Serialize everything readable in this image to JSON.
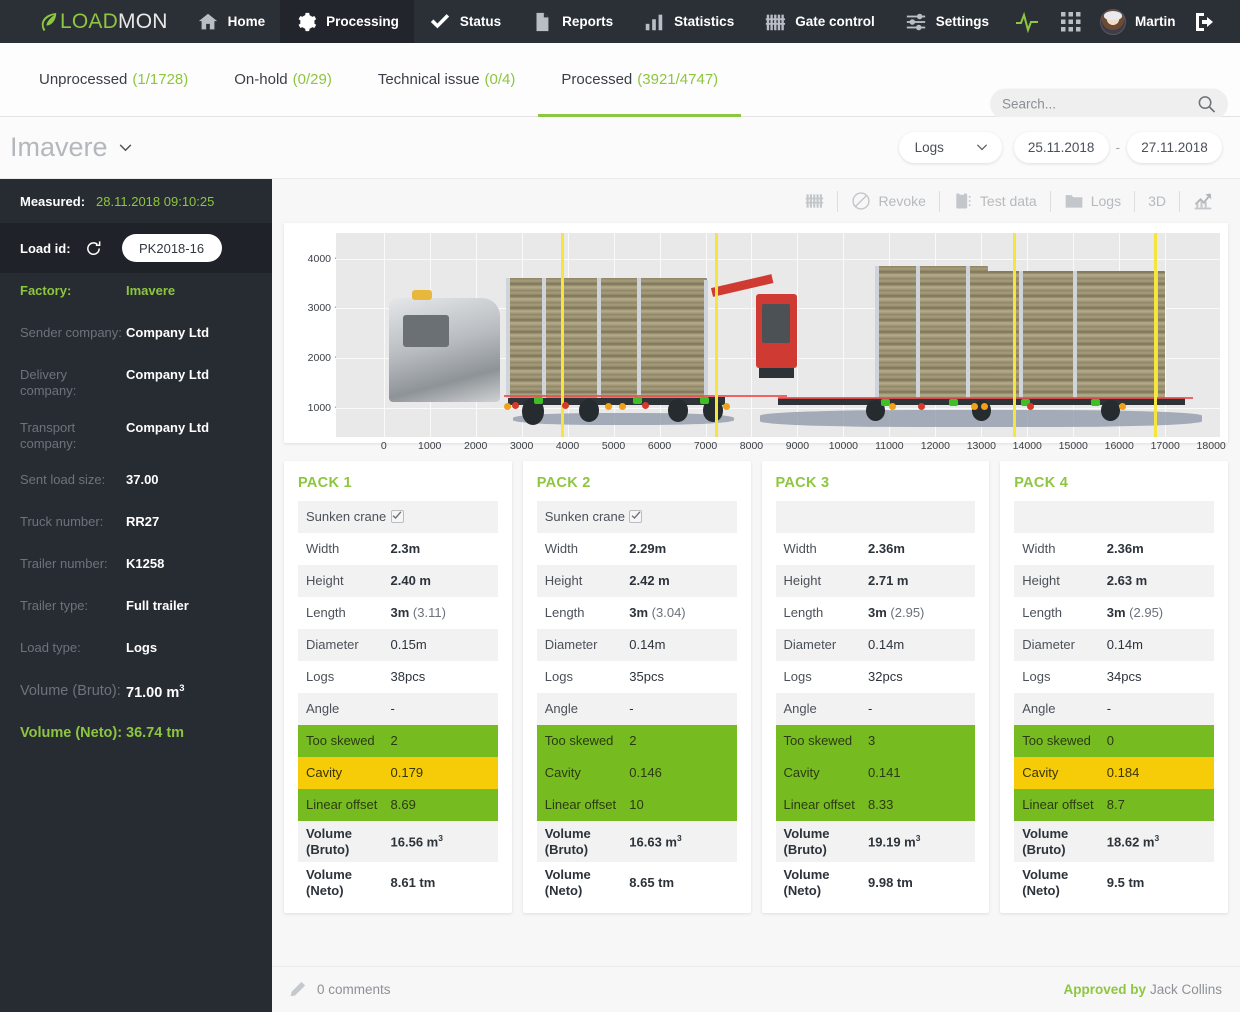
{
  "brand": {
    "load": "LOAD",
    "mon": "MON",
    "accent": "#8dc63f"
  },
  "topnav": {
    "items": [
      {
        "label": "Home",
        "icon": "home-icon",
        "active": false
      },
      {
        "label": "Processing",
        "icon": "gear-icon",
        "active": true
      },
      {
        "label": "Status",
        "icon": "check-icon",
        "active": false
      },
      {
        "label": "Reports",
        "icon": "document-icon",
        "active": false
      },
      {
        "label": "Statistics",
        "icon": "bar-chart-icon",
        "active": false
      },
      {
        "label": "Gate control",
        "icon": "gate-icon",
        "active": false
      },
      {
        "label": "Settings",
        "icon": "sliders-icon",
        "active": false
      }
    ],
    "pulse_icon": "pulse-icon",
    "apps_icon": "grid-apps-icon",
    "username": "Martin",
    "logout_icon": "logout-icon"
  },
  "tabs": [
    {
      "label": "Unprocessed",
      "count": "(1/1728)",
      "active": false
    },
    {
      "label": "On-hold",
      "count": "(0/29)",
      "active": false
    },
    {
      "label": "Technical issue",
      "count": "(0/4)",
      "active": false
    },
    {
      "label": "Processed",
      "count": "(3921/4747)",
      "active": true
    }
  ],
  "search": {
    "placeholder": "Search...",
    "value": "",
    "icon": "search-icon"
  },
  "subheader": {
    "factory": "Imavere",
    "load_type_select": "Logs",
    "date_from": "25.11.2018",
    "date_to": "27.11.2018",
    "date_separator": "-"
  },
  "sidebar": {
    "measured_label": "Measured:",
    "measured_value": "28.11.2018 09:10:25",
    "load_id_label": "Load id:",
    "load_id_value": "PK2018-16",
    "refresh_icon": "refresh-icon",
    "fields": [
      {
        "key": "Factory:",
        "value": "Imavere",
        "accent": true
      },
      {
        "key": "Sender company:",
        "value": "Company Ltd"
      },
      {
        "key": "Delivery company:",
        "value": "Company Ltd"
      },
      {
        "key": "Transport company:",
        "value": "Company Ltd"
      },
      {
        "key": "Sent load size:",
        "value": "37.00"
      },
      {
        "key": "Truck number:",
        "value": "RR27"
      },
      {
        "key": "Trailer number:",
        "value": "K1258"
      },
      {
        "key": "Trailer type:",
        "value": "Full trailer"
      },
      {
        "key": "Load type:",
        "value": "Logs"
      },
      {
        "key": "Volume (Bruto):",
        "value": "71.00 m",
        "sup": "3"
      },
      {
        "key": "Volume (Neto):",
        "value": "36.74 tm",
        "accent": true,
        "big": true
      }
    ]
  },
  "toolbar": {
    "gate_icon": "gate-icon",
    "revoke": "Revoke",
    "revoke_icon": "no-entry-icon",
    "test_data": "Test data",
    "test_data_icon": "clipboard-icon",
    "logs": "Logs",
    "logs_icon": "folder-icon",
    "three_d": "3D",
    "trend_icon": "trend-up-icon"
  },
  "chart_data": {
    "type": "scatter",
    "title": "",
    "xlabel": "",
    "ylabel": "",
    "xlim": [
      -700,
      19000
    ],
    "ylim": [
      400,
      4400
    ],
    "x_ticks": [
      0,
      1000,
      2000,
      3000,
      4000,
      5000,
      6000,
      7000,
      8000,
      9000,
      10000,
      11000,
      12000,
      13000,
      14000,
      15000,
      16000,
      17000,
      18000
    ],
    "y_ticks": [
      1000,
      2000,
      3000,
      4000
    ],
    "grid": true,
    "legend": "none",
    "annotations": {
      "pack_boundary_lines_x": [
        4200,
        7550,
        14000,
        17050
      ],
      "boundary_color": "#f5e53c",
      "bed_line_color": "#ef4b4b",
      "marker_green": "#3fbf26",
      "marker_red": "#d63b2a",
      "marker_orange": "#f0a11c"
    },
    "series": [
      {
        "name": "Pack 1",
        "x_range": [
          2450,
          5100
        ],
        "height_mm": 2400
      },
      {
        "name": "Pack 2",
        "x_range": [
          5100,
          8200
        ],
        "height_mm": 2420
      },
      {
        "name": "Pack 3",
        "x_range": [
          11950,
          14900
        ],
        "height_mm": 2710
      },
      {
        "name": "Pack 4",
        "x_range": [
          14900,
          18600
        ],
        "height_mm": 2630
      }
    ]
  },
  "packs": [
    {
      "title": "PACK 1",
      "rows": [
        {
          "k": "Sunken crane",
          "v": "",
          "checkbox": true,
          "style": "alt"
        },
        {
          "k": "Width",
          "v": "2.3m",
          "bold": true
        },
        {
          "k": "Height",
          "v": "2.40 m",
          "bold": true,
          "style": "alt"
        },
        {
          "k": "Length",
          "v": "3m",
          "sub": " (3.11)",
          "bold": true
        },
        {
          "k": "Diameter",
          "v": "0.15m",
          "style": "alt"
        },
        {
          "k": "Logs",
          "v": "38pcs"
        },
        {
          "k": "Angle",
          "v": "-",
          "style": "alt"
        },
        {
          "k": "Too skewed",
          "v": "2",
          "style": "green"
        },
        {
          "k": "Cavity",
          "v": "0.179",
          "style": "yellow"
        },
        {
          "k": "Linear offset",
          "v": "8.69",
          "style": "green"
        },
        {
          "k": "Volume (Bruto)",
          "v": "16.56 m",
          "sup": "3",
          "style": "alt",
          "strong": true
        },
        {
          "k": "Volume (Neto)",
          "v": "8.61 tm",
          "strong": true
        }
      ]
    },
    {
      "title": "PACK 2",
      "rows": [
        {
          "k": "Sunken crane",
          "v": "",
          "checkbox": true,
          "style": "alt"
        },
        {
          "k": "Width",
          "v": "2.29m",
          "bold": true
        },
        {
          "k": "Height",
          "v": "2.42 m",
          "bold": true,
          "style": "alt"
        },
        {
          "k": "Length",
          "v": "3m",
          "sub": " (3.04)",
          "bold": true
        },
        {
          "k": "Diameter",
          "v": "0.14m",
          "style": "alt"
        },
        {
          "k": "Logs",
          "v": "35pcs"
        },
        {
          "k": "Angle",
          "v": "-",
          "style": "alt"
        },
        {
          "k": "Too skewed",
          "v": "2",
          "style": "green"
        },
        {
          "k": "Cavity",
          "v": "0.146",
          "style": "green"
        },
        {
          "k": "Linear offset",
          "v": "10",
          "style": "green"
        },
        {
          "k": "Volume (Bruto)",
          "v": "16.63 m",
          "sup": "3",
          "style": "alt",
          "strong": true
        },
        {
          "k": "Volume (Neto)",
          "v": "8.65 tm",
          "strong": true
        }
      ]
    },
    {
      "title": "PACK 3",
      "rows": [
        {
          "k": "",
          "v": "",
          "style": "alt"
        },
        {
          "k": "Width",
          "v": "2.36m",
          "bold": true
        },
        {
          "k": "Height",
          "v": "2.71 m",
          "bold": true,
          "style": "alt"
        },
        {
          "k": "Length",
          "v": "3m",
          "sub": " (2.95)",
          "bold": true
        },
        {
          "k": "Diameter",
          "v": "0.14m",
          "style": "alt"
        },
        {
          "k": "Logs",
          "v": "32pcs"
        },
        {
          "k": "Angle",
          "v": "-",
          "style": "alt"
        },
        {
          "k": "Too skewed",
          "v": "3",
          "style": "green"
        },
        {
          "k": "Cavity",
          "v": "0.141",
          "style": "green"
        },
        {
          "k": "Linear offset",
          "v": "8.33",
          "style": "green"
        },
        {
          "k": "Volume (Bruto)",
          "v": "19.19 m",
          "sup": "3",
          "style": "alt",
          "strong": true
        },
        {
          "k": "Volume (Neto)",
          "v": "9.98 tm",
          "strong": true
        }
      ]
    },
    {
      "title": "PACK 4",
      "rows": [
        {
          "k": "",
          "v": "",
          "style": "alt"
        },
        {
          "k": "Width",
          "v": "2.36m",
          "bold": true
        },
        {
          "k": "Height",
          "v": "2.63 m",
          "bold": true,
          "style": "alt"
        },
        {
          "k": "Length",
          "v": "3m",
          "sub": " (2.95)",
          "bold": true
        },
        {
          "k": "Diameter",
          "v": "0.14m",
          "style": "alt"
        },
        {
          "k": "Logs",
          "v": "34pcs"
        },
        {
          "k": "Angle",
          "v": "-",
          "style": "alt"
        },
        {
          "k": "Too skewed",
          "v": "0",
          "style": "green"
        },
        {
          "k": "Cavity",
          "v": "0.184",
          "style": "yellow"
        },
        {
          "k": "Linear offset",
          "v": "8.7",
          "style": "green"
        },
        {
          "k": "Volume (Bruto)",
          "v": "18.62 m",
          "sup": "3",
          "style": "alt",
          "strong": true
        },
        {
          "k": "Volume (Neto)",
          "v": "9.5 tm",
          "strong": true
        }
      ]
    }
  ],
  "footer": {
    "comments": "0 comments",
    "comments_icon": "pencil-icon",
    "approved_by": "Approved by",
    "approver": "Jack Collins"
  }
}
